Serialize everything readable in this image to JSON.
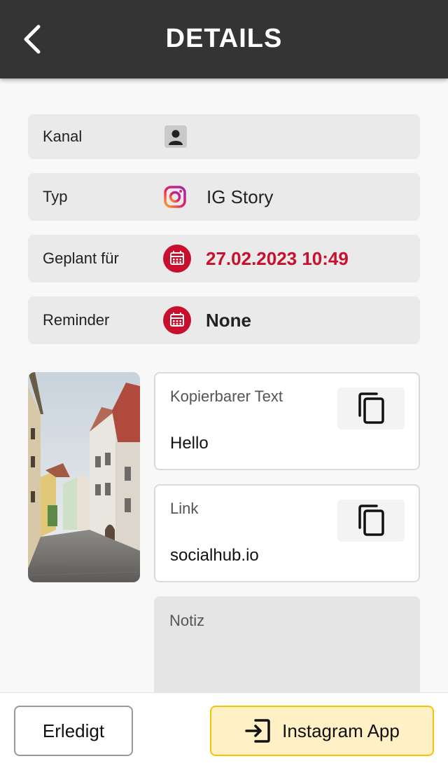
{
  "header": {
    "title": "DETAILS",
    "back_icon": "chevron-left-icon"
  },
  "details": {
    "channel": {
      "label": "Kanal",
      "icon": "user-avatar-icon"
    },
    "type": {
      "label": "Typ",
      "icon": "instagram-icon",
      "value": "IG Story"
    },
    "scheduled": {
      "label": "Geplant für",
      "icon": "calendar-icon",
      "value": "27.02.2023 10:49"
    },
    "reminder": {
      "label": "Reminder",
      "icon": "calendar-icon",
      "value": "None"
    }
  },
  "copy_text": {
    "label": "Kopierbarer Text",
    "value": "Hello",
    "icon": "copy-icon"
  },
  "link": {
    "label": "Link",
    "value": "socialhub.io",
    "icon": "copy-icon"
  },
  "note": {
    "label": "Notiz"
  },
  "footer": {
    "done_label": "Erledigt",
    "app_label": "Instagram App",
    "app_icon": "open-external-icon"
  },
  "colors": {
    "header_bg": "#343434",
    "accent_red": "#c8102e",
    "app_button_bg": "#fff0c6",
    "app_button_border": "#f5c400"
  }
}
